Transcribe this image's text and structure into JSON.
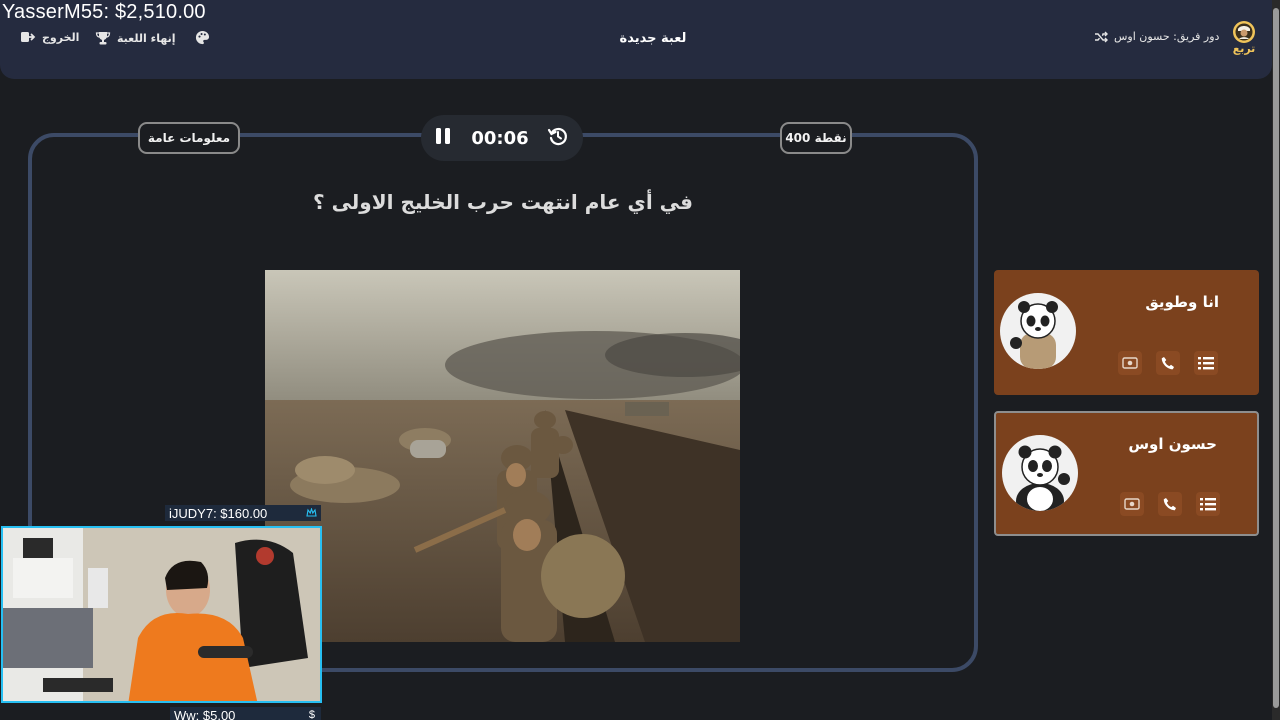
{
  "stream": {
    "top_donation": "YasserM55: $2,510.00",
    "donation_small": "iJUDY7: $160.00",
    "donation_bottom": "Ww: $5.00",
    "dollar_sign": "$"
  },
  "header": {
    "title": "لعبة جديدة",
    "exit_label": "الخروج",
    "end_game_label": "إنهاء اللعبة",
    "turn_label": "دور فريق: حسون اوس",
    "logo_text": "تربع"
  },
  "question_card": {
    "category": "معلومات عامة",
    "points": "400 نقطة",
    "timer": "00:06",
    "question": "في أي عام انتهت حرب الخليج الاولى ؟"
  },
  "teams": [
    {
      "name": "انا وطويق",
      "active": false
    },
    {
      "name": "حسون اوس",
      "active": true
    }
  ],
  "colors": {
    "header_bg": "#252b3f",
    "page_bg": "#1b1d21",
    "card_border": "#3c4a66",
    "team_bg": "#7b411d",
    "cam_border": "#27bff2"
  },
  "icons": {
    "exit": "logout-icon",
    "end_game": "trophy-icon",
    "theme": "palette-icon",
    "turn": "shuffle-icon",
    "pause": "pause-icon",
    "reset": "history-icon",
    "tool_list": "list-icon",
    "tool_call": "phone-icon",
    "tool_swap": "swap-icon"
  }
}
